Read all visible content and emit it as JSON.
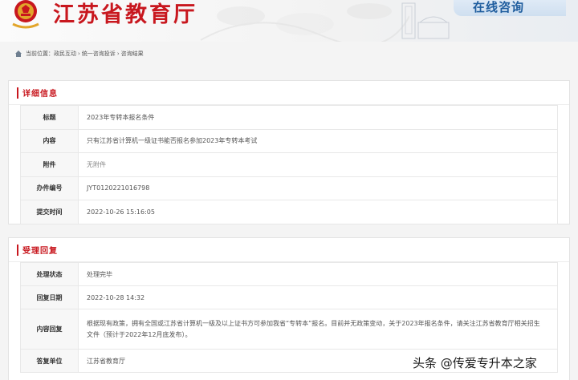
{
  "header": {
    "site_title": "江苏省教育厅",
    "badge": "在线咨询"
  },
  "breadcrumb": {
    "prefix": "当前位置：",
    "items": [
      "政民互动",
      "统一咨询投诉",
      "咨询结果"
    ],
    "separator": "›"
  },
  "detail": {
    "title": "详细信息",
    "rows": [
      {
        "label": "标题",
        "value": "2023年专转本报名条件"
      },
      {
        "label": "内容",
        "value": "只有江苏省计算机一级证书能否报名参加2023年专转本考试"
      },
      {
        "label": "附件",
        "value": "无附件"
      },
      {
        "label": "办件编号",
        "value": "JYT0120221016798"
      },
      {
        "label": "提交时间",
        "value": "2022-10-26 15:16:05"
      }
    ]
  },
  "reply": {
    "title": "受理回复",
    "rows": [
      {
        "label": "处理状态",
        "value": "处理完毕"
      },
      {
        "label": "回复日期",
        "value": "2022-10-28 14:32"
      },
      {
        "label": "内容回复",
        "value": "根据现有政策，拥有全国或江苏省计算机一级及以上证书方可参加我省“专转本”报名。目前并无政策变动，关于2023年报名条件，请关注江苏省教育厅相关招生文件（预计于2022年12月底发布）。"
      },
      {
        "label": "答复单位",
        "value": "江苏省教育厅"
      }
    ]
  },
  "watermark": "头条 @传爱专升本之家",
  "colors": {
    "accent_red": "#c8171e",
    "badge_blue": "#1f5d9e"
  }
}
